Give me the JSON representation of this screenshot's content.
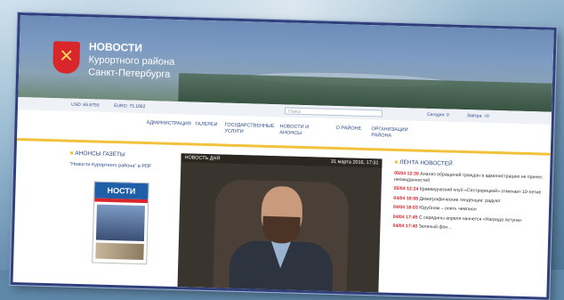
{
  "header": {
    "title_line1": "НОВОСТИ",
    "title_line2": "Курортного района",
    "title_line3": "Санкт-Петербурга",
    "logo_color": "#d8262b"
  },
  "rates": {
    "usd": "USD: 65.6755",
    "euro": "EURO: 75.1662",
    "search_placeholder": "Поиск",
    "today": "Сегодня: 0",
    "tomorrow": "Завтра: +0"
  },
  "menu": {
    "items": [
      "АДМИНИСТРАЦИЯ",
      "ГАЛЕРЕИ",
      "ГОСУДАРСТВЕННЫЕ УСЛУГИ",
      "НОВОСТИ И АНОНСЫ",
      "О РАЙОНЕ",
      "ОРГАНИЗАЦИИ РАЙОНА"
    ],
    "accent_color": "#f3c23c"
  },
  "announcements": {
    "title": "АНОНСЫ ГАЗЕТЫ",
    "pdf_link": "\"Новости Курортного района\" в PDF",
    "paper_masthead": "НОСТИ"
  },
  "news_of_day": {
    "label": "НОВОСТЬ ДНЯ",
    "date": "31 марта 2016, 17:31"
  },
  "news_feed": {
    "title": "ЛЕНТА НОВОСТЕЙ",
    "items": [
      {
        "time": "05/04 12:30",
        "text": "Анализ обращений граждан в администрацию не принес неожиданностей"
      },
      {
        "time": "05/04 12:24",
        "text": "Краеведческий клуб «Сестрорецкий» отмечает 10-летие"
      },
      {
        "time": "04/04 18:08",
        "text": "Демографические тенденции: радуют"
      },
      {
        "time": "04/04 18:03",
        "text": "Юрубном – опять чемпион"
      },
      {
        "time": "04/04 17:45",
        "text": "С середины апреля начнется «Награда летуна»"
      },
      {
        "time": "04/04 17:40",
        "text": "Зеленый фон..."
      }
    ],
    "time_color": "#d8262b"
  }
}
